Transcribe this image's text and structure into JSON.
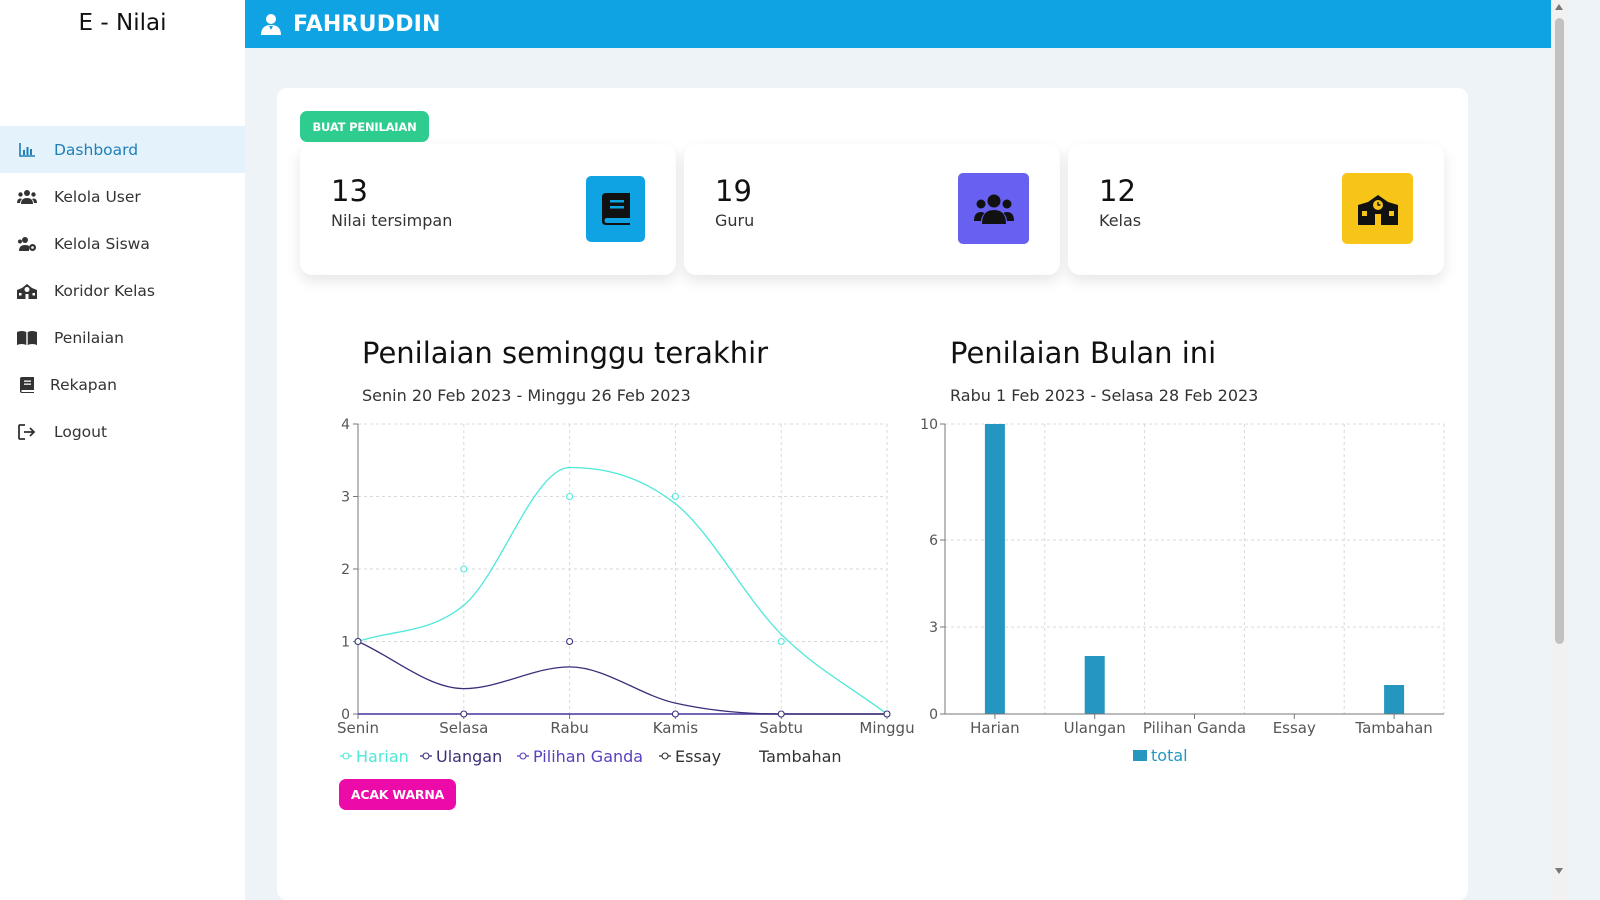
{
  "brand": "E - Nilai",
  "sidebar": {
    "items": [
      {
        "label": "Dashboard",
        "icon": "bar-chart-icon",
        "active": true
      },
      {
        "label": "Kelola User",
        "icon": "users-icon"
      },
      {
        "label": "Kelola Siswa",
        "icon": "users-cog-icon"
      },
      {
        "label": "Koridor Kelas",
        "icon": "school-icon"
      },
      {
        "label": "Penilaian",
        "icon": "book-open-icon"
      },
      {
        "label": "Rekapan",
        "icon": "book-icon"
      },
      {
        "label": "Logout",
        "icon": "logout-icon"
      }
    ]
  },
  "topbar": {
    "username": "FAHRUDDIN",
    "icon": "user-icon",
    "color": "#10a3e3"
  },
  "buat_penilaian_label": "BUAT PENILAIAN",
  "stats": [
    {
      "value": "13",
      "label": "Nilai tersimpan",
      "icon": "book-icon",
      "color": "#10a3e3"
    },
    {
      "value": "19",
      "label": "Guru",
      "icon": "users-icon",
      "color": "#6760f0"
    },
    {
      "value": "12",
      "label": "Kelas",
      "icon": "school-icon",
      "color": "#f7c518"
    }
  ],
  "weekly": {
    "title": "Penilaian seminggu terakhir",
    "subtitle": "Senin 20 Feb 2023 - Minggu 26 Feb 2023"
  },
  "monthly": {
    "title": "Penilaian Bulan ini",
    "subtitle": "Rabu 1 Feb 2023 - Selasa 28 Feb 2023"
  },
  "acak_warna_label": "ACAK WARNA",
  "chart_data": [
    {
      "type": "line",
      "x": [
        "Senin",
        "Selasa",
        "Rabu",
        "Kamis",
        "Sabtu",
        "Minggu"
      ],
      "ylim": [
        0,
        4
      ],
      "yticks": [
        0,
        1,
        2,
        3,
        4
      ],
      "grid": true,
      "legend_position": "bottom",
      "series": [
        {
          "name": "Harian",
          "values": [
            1,
            1.5,
            3.4,
            2.9,
            1.1,
            0
          ],
          "color": "#4de8d8"
        },
        {
          "name": "Ulangan",
          "values": [
            1,
            0.35,
            0.65,
            0.15,
            0,
            0
          ],
          "color": "#3a2f7a"
        },
        {
          "name": "Pilihan Ganda",
          "values": [
            0,
            0,
            0,
            0,
            0,
            0
          ],
          "color": "#5b3fbf"
        },
        {
          "name": "Essay",
          "values": [
            0,
            0,
            0,
            0,
            0,
            0
          ],
          "color": "#333333"
        },
        {
          "name": "Tambahan",
          "values": [
            0,
            0,
            0,
            0,
            0,
            0
          ],
          "color": "#333333"
        }
      ]
    },
    {
      "type": "bar",
      "categories": [
        "Harian",
        "Ulangan",
        "Pilihan Ganda",
        "Essay",
        "Tambahan"
      ],
      "ylim": [
        0,
        10
      ],
      "yticks": [
        0,
        3,
        6,
        10
      ],
      "grid": true,
      "legend_position": "bottom",
      "series": [
        {
          "name": "total",
          "values": [
            10,
            2,
            0,
            0,
            1
          ],
          "color": "#2596c0"
        }
      ]
    }
  ]
}
